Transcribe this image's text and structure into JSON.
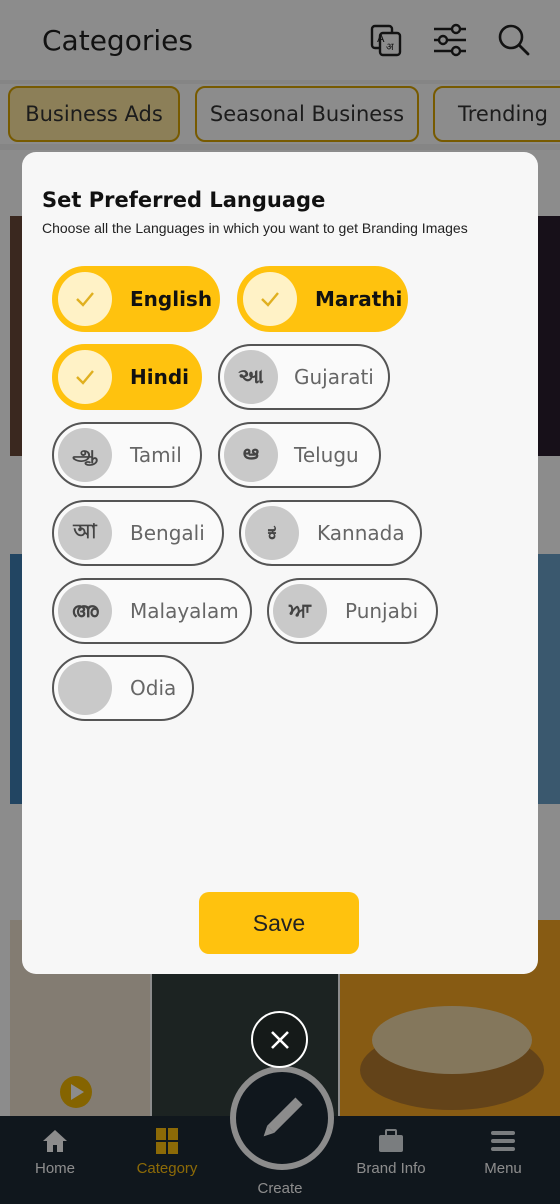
{
  "app": {
    "title": "Categories"
  },
  "header_icons": [
    "translate-icon",
    "filter-sliders-icon",
    "search-icon"
  ],
  "category_chips": [
    {
      "label": "Business Ads",
      "active": true
    },
    {
      "label": "Seasonal Business",
      "active": false
    },
    {
      "label": "Trending",
      "active": false
    }
  ],
  "modal": {
    "title": "Set Preferred Language",
    "subtitle": "Choose all the Languages in which you want to get Branding Images",
    "save_label": "Save",
    "languages": [
      {
        "label": "English",
        "glyph": "✓",
        "selected": true
      },
      {
        "label": "Marathi",
        "glyph": "✓",
        "selected": true
      },
      {
        "label": "Hindi",
        "glyph": "✓",
        "selected": true
      },
      {
        "label": "Gujarati",
        "glyph": "આ",
        "selected": false
      },
      {
        "label": "Tamil",
        "glyph": "ஆ",
        "selected": false
      },
      {
        "label": "Telugu",
        "glyph": "ఆ",
        "selected": false
      },
      {
        "label": "Bengali",
        "glyph": "আ",
        "selected": false
      },
      {
        "label": "Kannada",
        "glyph": "ಕ",
        "selected": false
      },
      {
        "label": "Malayalam",
        "glyph": "അ",
        "selected": false
      },
      {
        "label": "Punjabi",
        "glyph": "ਆ",
        "selected": false
      },
      {
        "label": "Odia",
        "glyph": "",
        "selected": false
      }
    ]
  },
  "bottom_nav": {
    "items": [
      {
        "label": "Home",
        "icon": "home-icon",
        "active": false
      },
      {
        "label": "Category",
        "icon": "category-grid-icon",
        "active": true
      },
      {
        "label": "Create",
        "icon": "pencil-icon",
        "active": false
      },
      {
        "label": "Brand Info",
        "icon": "briefcase-icon",
        "active": false
      },
      {
        "label": "Menu",
        "icon": "hamburger-menu-icon",
        "active": false
      }
    ]
  },
  "colors": {
    "accent": "#ffc20e",
    "nav_bg": "#1e2a36",
    "scrim": "rgba(0,0,0,0.45)"
  }
}
